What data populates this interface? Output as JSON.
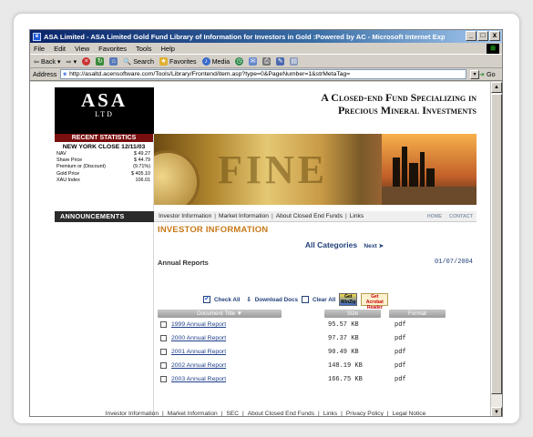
{
  "window": {
    "title": "ASA Limited - ASA Limited Gold Fund Library of Information for Investors in Gold :Powered by AC - Microsoft Internet Explo...",
    "min_label": "_",
    "max_label": "□",
    "close_label": "x"
  },
  "menu": [
    "File",
    "Edit",
    "View",
    "Favorites",
    "Tools",
    "Help"
  ],
  "toolbar": {
    "back_label": "Back",
    "search_label": "Search",
    "favorites_label": "Favorites",
    "media_label": "Media"
  },
  "address": {
    "label": "Address",
    "url": "http://asaltd.acensoftware.com/Tools/Library/Frontend/item.asp?type=0&PageNumber=1&strMetaTag=",
    "go_label": "Go"
  },
  "site": {
    "logo_big": "ASA",
    "logo_small": "LTD",
    "tagline_line1": "A Closed-end Fund Specializing in",
    "tagline_line2": "Precious Mineral Investments",
    "banner_text": "FINE"
  },
  "stats": {
    "header": "RECENT STATISTICS",
    "close_label": "NEW YORK CLOSE 12/11/03",
    "rows": [
      {
        "label": "NAV",
        "value": "$ 49.27"
      },
      {
        "label": "Share Price",
        "value": "$ 44.79"
      },
      {
        "label": "Premium or (Discount)",
        "value": "(9.71%)"
      },
      {
        "label": "Gold Price",
        "value": "$ 405.10"
      },
      {
        "label": "XAU Index",
        "value": "106.01"
      }
    ]
  },
  "nav": {
    "announcements": "ANNOUNCEMENTS",
    "links": [
      "Investor Information",
      "Market Information",
      "About Closed End Funds",
      "Links"
    ],
    "home": "HOME",
    "contact": "CONTACT"
  },
  "main": {
    "section_title": "INVESTOR INFORMATION",
    "all_categories": "All Categories",
    "next": "Next",
    "report_heading": "Annual Reports",
    "report_date": "01/07/2004",
    "check_all": "Check All",
    "download_docs": "Download Docs",
    "clear_all": "Clear All",
    "winzip_label": "Get WinZip",
    "acrobat_label": "Get Acrobat Reader",
    "col_title": "Document Title ▼",
    "col_size": "Size",
    "col_format": "Format",
    "rows": [
      {
        "name": "1999 Annual Report",
        "size": "95.57 KB",
        "format": "pdf"
      },
      {
        "name": "2000 Annual Report",
        "size": "97.37 KB",
        "format": "pdf"
      },
      {
        "name": "2001 Annual Report",
        "size": "90.49 KB",
        "format": "pdf"
      },
      {
        "name": "2002 Annual Report",
        "size": "148.19 KB",
        "format": "pdf"
      },
      {
        "name": "2003 Annual Report",
        "size": "166.75 KB",
        "format": "pdf"
      }
    ]
  },
  "footer": [
    "Investor Information",
    "Market Information",
    "SEC",
    "About Closed End Funds",
    "Links",
    "Privacy Policy",
    "Legal Notice"
  ]
}
